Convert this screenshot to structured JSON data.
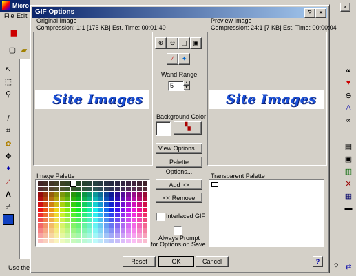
{
  "app": {
    "title_fragment": "Micro",
    "menu": [
      "File",
      "Edit"
    ],
    "status_text": "Use the"
  },
  "dialog": {
    "title": "GIF Options",
    "help_label": "?",
    "close_label": "×",
    "original": {
      "label": "Original Image",
      "compression": "Compression: 1:1 [175 KB]  Est. Time: 00:01:40",
      "logo_text": "Site Images"
    },
    "preview": {
      "label": "Preview Image",
      "compression": "Compression: 24:1 [7 KB]  Est. Time: 00:00:04",
      "logo_text": "Site Images"
    },
    "wand_range": {
      "label": "Wand Range",
      "value": "5"
    },
    "background_color": {
      "label": "Background Color",
      "swatch": "#ffffff"
    },
    "buttons": {
      "view_options": "View Options...",
      "palette_options": "Palette Options...",
      "add": "Add >>",
      "remove": "<< Remove",
      "reset": "Reset",
      "ok": "OK",
      "cancel": "Cancel"
    },
    "image_palette": {
      "label": "Image Palette"
    },
    "transparent_palette": {
      "label": "Transparent Palette"
    },
    "interlaced": {
      "label": "Interlaced GIF",
      "checked": false
    },
    "always_prompt": {
      "line1": "Always Prompt",
      "line2": "for Options on Save",
      "checked": false
    },
    "palette_colors": [
      "#000000",
      "#800000",
      "#008000",
      "#808000",
      "#000080",
      "#800080",
      "#008080",
      "#c0c0c0",
      "#808080",
      "#ff0000",
      "#00ff00",
      "#ffff00",
      "#0000ff",
      "#ff00ff",
      "#00ffff",
      "#ffffff"
    ]
  }
}
